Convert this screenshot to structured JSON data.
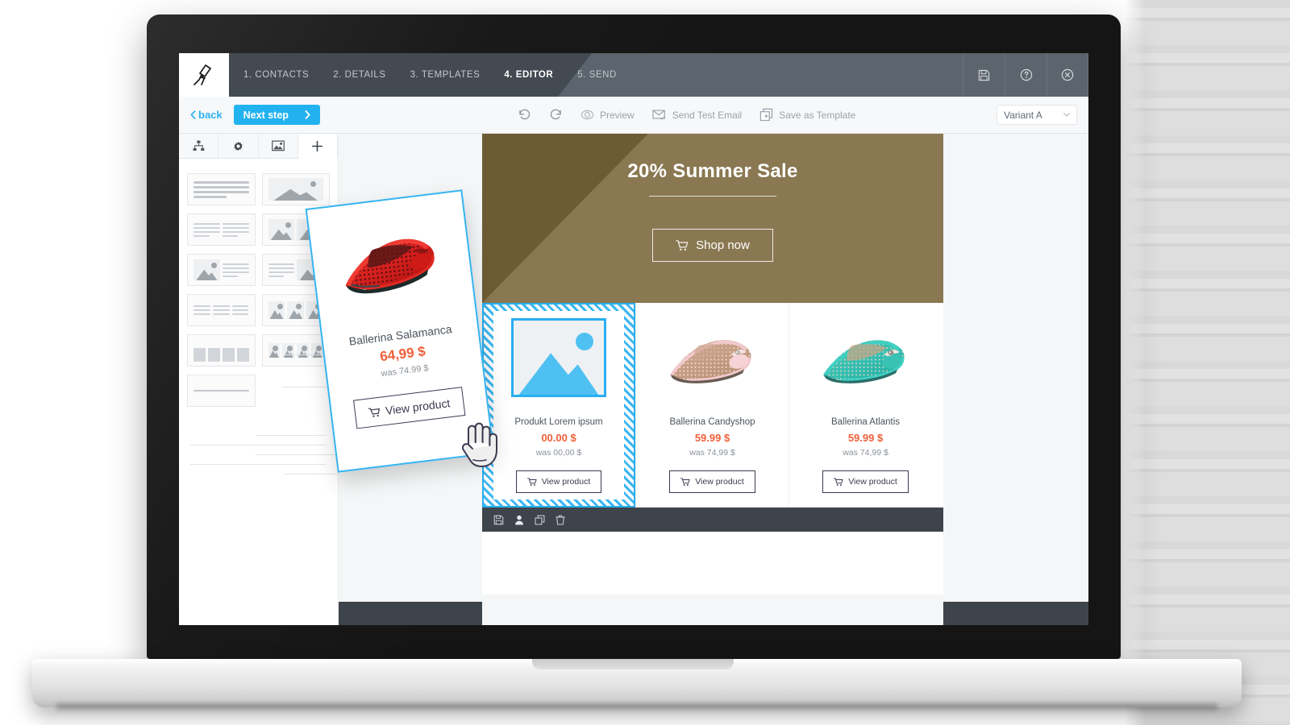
{
  "app": {
    "logo_name": "mailman-logo"
  },
  "topnav": {
    "steps": [
      {
        "label": "1. CONTACTS",
        "active": false
      },
      {
        "label": "2. DETAILS",
        "active": false
      },
      {
        "label": "3. TEMPLATES",
        "active": false
      },
      {
        "label": "4. EDITOR",
        "active": true
      },
      {
        "label": "5. SEND",
        "active": false
      }
    ],
    "icons": [
      {
        "name": "save-icon"
      },
      {
        "name": "help-icon"
      },
      {
        "name": "close-icon"
      }
    ]
  },
  "toolbar": {
    "back_label": "back",
    "next_label": "Next step",
    "undo_icon": "undo-icon",
    "redo_icon": "redo-icon",
    "preview_label": "Preview",
    "send_test_label": "Send Test Email",
    "save_template_label": "Save as Template",
    "variant_label": "Variant A"
  },
  "left_panel": {
    "tabs": [
      {
        "name": "structure-tab",
        "active": true
      },
      {
        "name": "settings-tab",
        "active": false
      },
      {
        "name": "images-tab",
        "active": false
      },
      {
        "name": "add-tab",
        "active": false
      }
    ],
    "thumbnails": [
      {
        "name": "layout-text-block"
      },
      {
        "name": "layout-single-image"
      },
      {
        "name": "layout-two-text-columns"
      },
      {
        "name": "layout-two-images"
      },
      {
        "name": "layout-image-left-text-right"
      },
      {
        "name": "layout-text-left-image-right"
      },
      {
        "name": "layout-three-text-columns"
      },
      {
        "name": "layout-three-images"
      },
      {
        "name": "layout-four-blocks"
      },
      {
        "name": "layout-four-images"
      },
      {
        "name": "layout-divider"
      }
    ]
  },
  "email": {
    "banner": {
      "title": "20% Summer Sale",
      "cta_label": "Shop now",
      "bg_color": "#8a7852",
      "wedge_color": "#6d5c33"
    },
    "products": [
      {
        "name": "Produkt Lorem ipsum",
        "price": "00.00 $",
        "was": "was  00,00 $",
        "button": "View product",
        "is_drop_target": true,
        "image": "image-placeholder"
      },
      {
        "name": "Ballerina Candyshop",
        "price": "59.99 $",
        "was": "was 74,99 $",
        "button": "View product",
        "is_drop_target": false,
        "image": "pink-ballerina-shoe"
      },
      {
        "name": "Ballerina Atlantis",
        "price": "59.99 $",
        "was": "was 74,99 $",
        "button": "View product",
        "is_drop_target": false,
        "image": "teal-ballerina-shoe"
      }
    ],
    "block_tools": [
      {
        "name": "save-block-icon"
      },
      {
        "name": "personalize-icon"
      },
      {
        "name": "duplicate-block-icon"
      },
      {
        "name": "delete-block-icon"
      }
    ]
  },
  "drag_card": {
    "name": "Ballerina Salamanca",
    "price": "64,99 $",
    "was": "was 74.99 $",
    "button": "View product",
    "image": "red-ballerina-shoe",
    "accent_color": "#35b4f0"
  },
  "colors": {
    "accent": "#22b2f0",
    "price": "#f0603a",
    "nav_bg": "#434a52",
    "nav_bg_light": "#5c646d"
  }
}
